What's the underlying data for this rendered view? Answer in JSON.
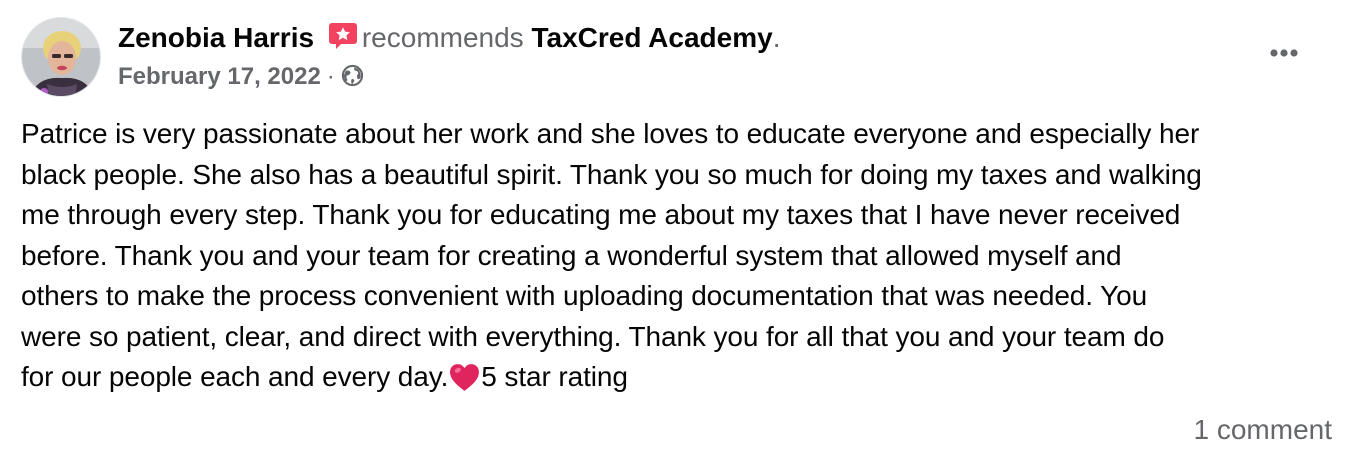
{
  "post": {
    "author": "Zenobia Harris",
    "recommends_text": "recommends",
    "page_name": "TaxCred Academy",
    "period": ".",
    "date": "February 17, 2022",
    "separator": "·",
    "audience_icon": "globe-icon",
    "recommend_icon": "recommend-badge-icon",
    "more_icon": "more-options-icon",
    "body_lines": [
      "Patrice is very passionate about her work and she loves to educate everyone and especially her",
      "black people. She also has a beautiful spirit. Thank you so much for doing my taxes and walking",
      "me through every step. Thank you for educating me about my taxes that I have never received",
      "before. Thank you and your team for creating a wonderful system that allowed myself and",
      "others to make the process convenient with uploading documentation that was needed. You",
      "were so patient, clear, and direct with everything. Thank you for all that you and your team do",
      "for our people each and every day."
    ],
    "heart_icon": "red-heart-icon",
    "rating_text": "5 star rating",
    "comments": "1 comment"
  },
  "colors": {
    "primary_text": "#050505",
    "secondary_text": "#65676b",
    "recommend_badge": "#f3425f",
    "heart": "#e0245e"
  }
}
